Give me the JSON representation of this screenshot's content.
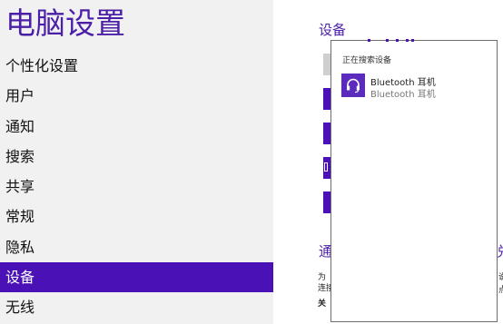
{
  "app": {
    "title": "电脑设置"
  },
  "nav": {
    "items": [
      {
        "label": "个性化设置"
      },
      {
        "label": "用户"
      },
      {
        "label": "通知"
      },
      {
        "label": "搜索"
      },
      {
        "label": "共享"
      },
      {
        "label": "常规"
      },
      {
        "label": "隐私"
      },
      {
        "label": "设备",
        "selected": true
      },
      {
        "label": "无线"
      }
    ]
  },
  "main": {
    "section_title": "设备",
    "partial_heading": "通",
    "partial_heading_right": "兑",
    "partial_lines": [
      "为",
      "连接",
      "关"
    ],
    "partial_right": [
      "说",
      "点"
    ]
  },
  "flyout": {
    "status": "正在搜索设备",
    "devices": [
      {
        "name": "Bluetooth 耳机",
        "subname": "Bluetooth 耳机",
        "icon": "headset-icon"
      }
    ]
  },
  "colors": {
    "accent": "#4a12b6",
    "title": "#4b1fa8",
    "pane_bg": "#f1f1f1"
  }
}
